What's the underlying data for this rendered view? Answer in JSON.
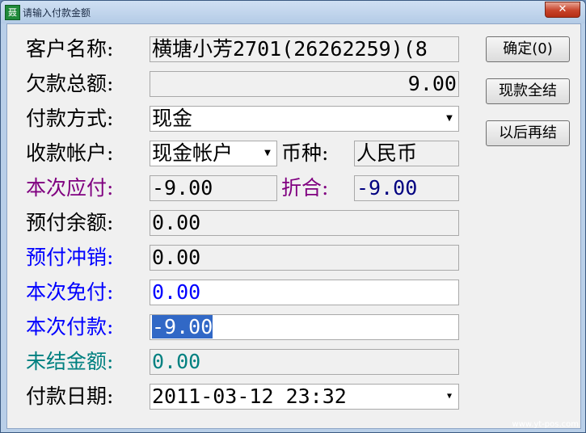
{
  "window": {
    "title": "请输入付款金额",
    "app_icon_glyph": "聂",
    "close_glyph": "✕"
  },
  "labels": {
    "customer_name": "客户名称:",
    "total_owed": "欠款总额:",
    "payment_method": "付款方式:",
    "receiving_account": "收款帐户:",
    "currency": "币种:",
    "amount_due": "本次应付:",
    "converted": "折合:",
    "prepaid_balance": "预付余额:",
    "prepaid_offset": "预付冲销:",
    "waived": "本次免付:",
    "payment": "本次付款:",
    "unsettled": "未结金额:",
    "payment_date": "付款日期:"
  },
  "values": {
    "customer_name": "横塘小芳2701(26262259)(8",
    "total_owed": "9.00",
    "payment_method": "现金",
    "receiving_account": "现金帐户",
    "currency": "人民币",
    "amount_due": "-9.00",
    "converted": "-9.00",
    "prepaid_balance": "0.00",
    "prepaid_offset": "0.00",
    "waived": "0.00",
    "payment": "-9.00",
    "unsettled": "0.00",
    "payment_date": "2011-03-12 23:32"
  },
  "buttons": {
    "confirm": "确定(0)",
    "settle_cash": "现款全结",
    "settle_later": "以后再结"
  },
  "colors": {
    "purple": "#800080",
    "blue": "#0000ff",
    "teal": "#008080",
    "navy": "#000080",
    "selection": "#3168c6"
  },
  "watermark": "www.yt-pos.com"
}
